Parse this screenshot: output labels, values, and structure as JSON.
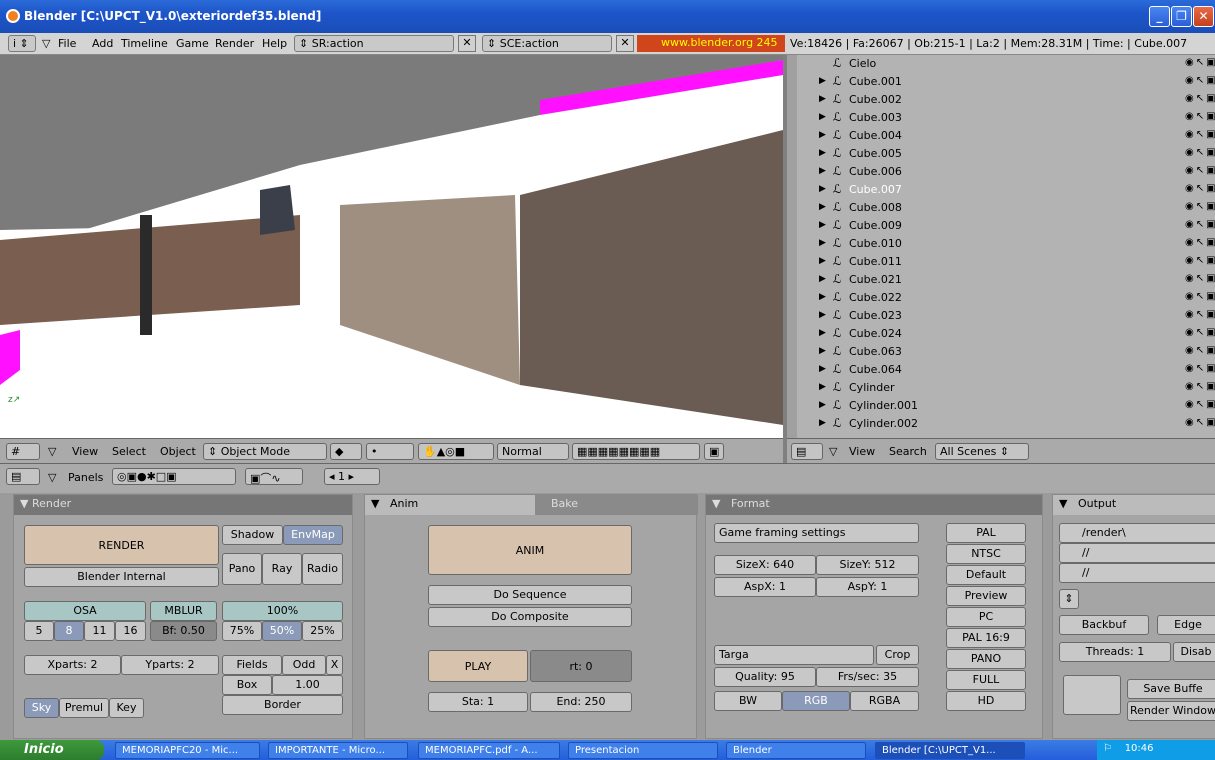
{
  "window": {
    "title": "Blender [C:\\UPCT_V1.0\\exteriordef35.blend]"
  },
  "menu": {
    "items": [
      "File",
      "Add",
      "Timeline",
      "Game",
      "Render",
      "Help"
    ],
    "screen": "SR:action",
    "scene": "SCE:action",
    "site": "www.blender.org 245",
    "stats": "Ve:18426 | Fa:26067 | Ob:215-1 | La:2  | Mem:28.31M | Time: | Cube.007"
  },
  "viewport_header": {
    "view": "View",
    "select": "Select",
    "object": "Object",
    "mode": "Object Mode",
    "shading": "Normal"
  },
  "outliner": {
    "items": [
      {
        "name": "Cielo",
        "sel": false,
        "expander": false
      },
      {
        "name": "Cube.001",
        "sel": false,
        "expander": true
      },
      {
        "name": "Cube.002",
        "sel": false,
        "expander": true
      },
      {
        "name": "Cube.003",
        "sel": false,
        "expander": true
      },
      {
        "name": "Cube.004",
        "sel": false,
        "expander": true
      },
      {
        "name": "Cube.005",
        "sel": false,
        "expander": true
      },
      {
        "name": "Cube.006",
        "sel": false,
        "expander": true
      },
      {
        "name": "Cube.007",
        "sel": true,
        "expander": true
      },
      {
        "name": "Cube.008",
        "sel": false,
        "expander": true
      },
      {
        "name": "Cube.009",
        "sel": false,
        "expander": true
      },
      {
        "name": "Cube.010",
        "sel": false,
        "expander": true
      },
      {
        "name": "Cube.011",
        "sel": false,
        "expander": true
      },
      {
        "name": "Cube.021",
        "sel": false,
        "expander": true
      },
      {
        "name": "Cube.022",
        "sel": false,
        "expander": true
      },
      {
        "name": "Cube.023",
        "sel": false,
        "expander": true
      },
      {
        "name": "Cube.024",
        "sel": false,
        "expander": true
      },
      {
        "name": "Cube.063",
        "sel": false,
        "expander": true
      },
      {
        "name": "Cube.064",
        "sel": false,
        "expander": true
      },
      {
        "name": "Cylinder",
        "sel": false,
        "expander": true
      },
      {
        "name": "Cylinder.001",
        "sel": false,
        "expander": true
      },
      {
        "name": "Cylinder.002",
        "sel": false,
        "expander": true
      }
    ],
    "header": {
      "view": "View",
      "search": "Search",
      "scope": "All Scenes"
    }
  },
  "buttons_header": {
    "panels": "Panels",
    "frame": "1"
  },
  "render": {
    "title": "Render",
    "render": "RENDER",
    "shadow": "Shadow",
    "envmap": "EnvMap",
    "engine": "Blender Internal",
    "pano": "Pano",
    "ray": "Ray",
    "radio": "Radio",
    "osa": "OSA",
    "mblur": "MBLUR",
    "pct100": "100%",
    "osa_vals": [
      "5",
      "8",
      "11",
      "16"
    ],
    "bf": "Bf: 0.50",
    "pct": [
      "75%",
      "50%",
      "25%"
    ],
    "xparts": "Xparts: 2",
    "yparts": "Yparts: 2",
    "fields": "Fields",
    "odd": "Odd",
    "x": "X",
    "box": "Box",
    "filter": "1.00",
    "sky": "Sky",
    "premul": "Premul",
    "key": "Key",
    "border": "Border"
  },
  "anim": {
    "tab1": "Anim",
    "tab2": "Bake",
    "anim": "ANIM",
    "seq": "Do Sequence",
    "comp": "Do Composite",
    "play": "PLAY",
    "rt": "rt: 0",
    "sta": "Sta: 1",
    "end": "End: 250"
  },
  "format": {
    "title": "Format",
    "game": "Game framing settings",
    "sizex": "SizeX: 640",
    "sizey": "SizeY: 512",
    "aspx": "AspX: 1",
    "aspy": "AspY: 1",
    "presets": [
      "PAL",
      "NTSC",
      "Default",
      "Preview",
      "PC",
      "PAL 16:9",
      "PANO",
      "FULL",
      "HD"
    ],
    "type": "Targa",
    "crop": "Crop",
    "quality": "Quality: 95",
    "fps": "Frs/sec: 35",
    "bw": "BW",
    "rgb": "RGB",
    "rgba": "RGBA"
  },
  "output": {
    "title": "Output",
    "paths": [
      "/render\\",
      "//",
      "//"
    ],
    "backbuf": "Backbuf",
    "edge": "Edge",
    "threads": "Threads: 1",
    "disable": "Disab",
    "save": "Save Buffe",
    "rwin": "Render Window"
  },
  "taskbar": {
    "start": "Inicio",
    "tasks": [
      "MEMORIAPFC20 - Mic...",
      "IMPORTANTE - Micro...",
      "MEMORIAPFC.pdf - A...",
      "Presentacion",
      "Blender",
      "Blender [C:\\UPCT_V1..."
    ],
    "time": "10:46"
  }
}
